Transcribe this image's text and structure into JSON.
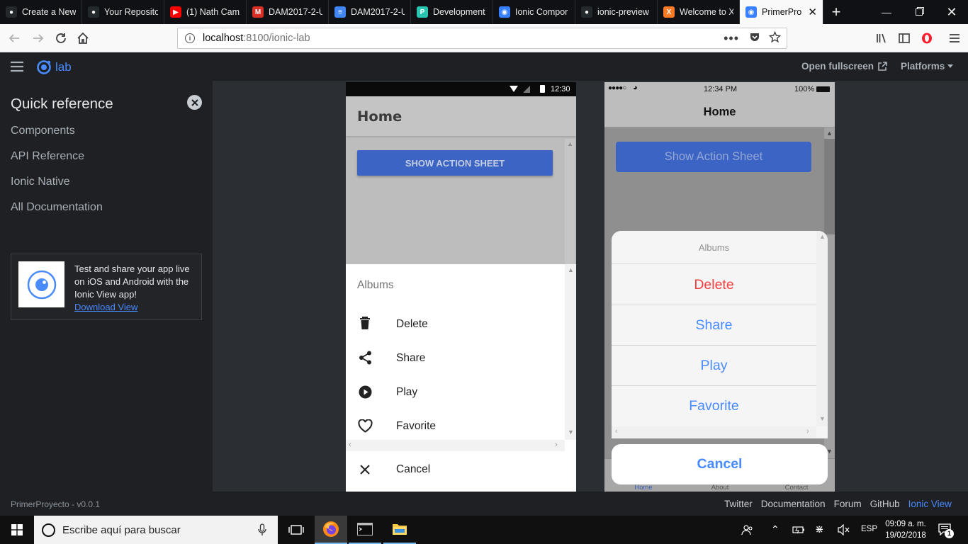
{
  "browser": {
    "tabs": [
      {
        "title": "Create a New",
        "icon": "github-icon",
        "color": "#24292e"
      },
      {
        "title": "Your Reposito",
        "icon": "github-icon",
        "color": "#24292e"
      },
      {
        "title": "(1) Nath Cam",
        "icon": "youtube-icon",
        "color": "#ff0000"
      },
      {
        "title": "DAM2017-2-U",
        "icon": "gmail-icon",
        "color": "#d93025"
      },
      {
        "title": "DAM2017-2-U",
        "icon": "docs-icon",
        "color": "#4285f4"
      },
      {
        "title": "Development",
        "icon": "app-icon",
        "color": "#28c5b1"
      },
      {
        "title": "Ionic Compor",
        "icon": "ionic-icon",
        "color": "#3880ff"
      },
      {
        "title": "ionic-preview",
        "icon": "github-icon",
        "color": "#24292e"
      },
      {
        "title": "Welcome to X",
        "icon": "xampp-icon",
        "color": "#fb7a24"
      },
      {
        "title": "PrimerPro",
        "icon": "ionic-icon",
        "color": "#3880ff",
        "active": true
      }
    ],
    "url_host": "localhost",
    "url_port": ":8100",
    "url_path": "/ionic-lab"
  },
  "lab": {
    "logo_text": "lab",
    "open_fullscreen": "Open fullscreen",
    "platforms": "Platforms",
    "sidebar": {
      "title": "Quick reference",
      "items": [
        "Components",
        "API Reference",
        "Ionic Native",
        "All Documentation"
      ],
      "promo_text": "Test and share your app live on iOS and Android with the Ionic View app!",
      "promo_link": "Download View"
    },
    "footer": {
      "version": "PrimerProyecto - v0.0.1",
      "links": [
        "Twitter",
        "Documentation",
        "Forum",
        "GitHub"
      ],
      "active_link": "Ionic View"
    }
  },
  "android": {
    "status_time": "12:30",
    "title": "Home",
    "button": "SHOW ACTION SHEET",
    "sheet_title": "Albums",
    "actions": [
      {
        "label": "Delete",
        "icon": "trash-icon"
      },
      {
        "label": "Share",
        "icon": "share-icon"
      },
      {
        "label": "Play",
        "icon": "play-icon"
      },
      {
        "label": "Favorite",
        "icon": "heart-icon"
      }
    ],
    "cancel": "Cancel"
  },
  "ios": {
    "status_time": "12:34 PM",
    "battery": "100%",
    "title": "Home",
    "button": "Show Action Sheet",
    "sheet_title": "Albums",
    "actions": [
      "Delete",
      "Share",
      "Play",
      "Favorite"
    ],
    "cancel": "Cancel",
    "tabs": [
      "Home",
      "About",
      "Contact"
    ]
  },
  "taskbar": {
    "search_placeholder": "Escribe aquí para buscar",
    "lang": "ESP",
    "time": "09:09 a. m.",
    "date": "19/02/2018",
    "notif_count": "1"
  },
  "colors": {
    "ionic_blue": "#488aff",
    "android_button": "#3c64c4",
    "ios_button": "#3c64c4",
    "ios_destructive": "#f53d3d",
    "ios_action": "#488aff"
  }
}
